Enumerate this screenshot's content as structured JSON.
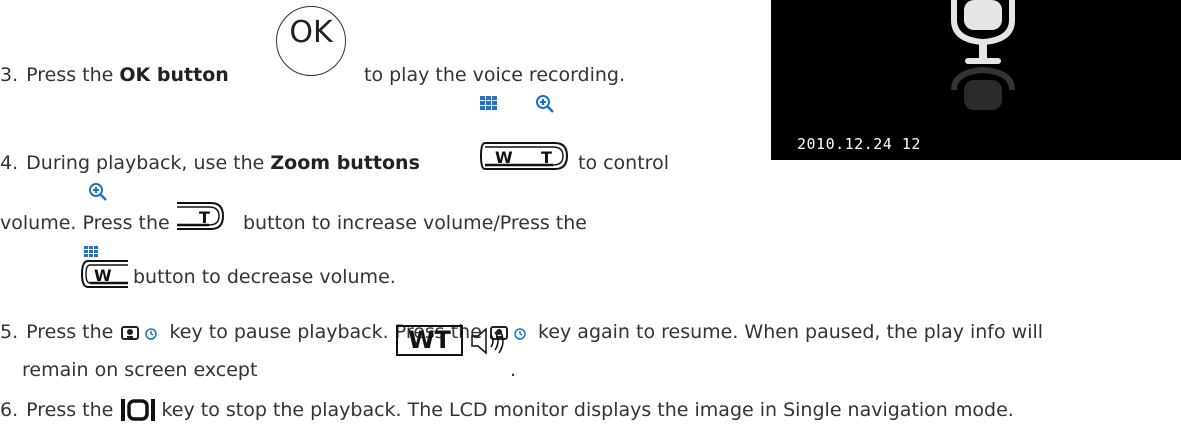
{
  "steps": [
    {
      "num": "3.",
      "pre": "Press the ",
      "bold": "OK button",
      "post": "to play the voice recording."
    },
    {
      "num": "4.",
      "pre": "During playback, use the ",
      "bold": "Zoom buttons",
      "post": "to control"
    },
    {
      "line2_pre": "volume. Press the ",
      "line2_post": "button to increase volume/Press the"
    },
    {
      "line3_post": "button to decrease volume."
    },
    {
      "num": "5.",
      "text_a": "Press the ",
      "text_b": " key to pause playback. Press the ",
      "text_c": " key again to resume. When paused, the play info will"
    },
    {
      "line2": "remain on screen except",
      "line2_end": "."
    },
    {
      "num": "6.",
      "pre": "Press the ",
      "post": " key to stop the playback. The LCD monitor displays the image in Single navigation mode."
    }
  ],
  "ok_label": "OK",
  "wt_label": "WT",
  "w_label": "W",
  "t_label": "T",
  "screen": {
    "timestamp": "2010.12.24  12"
  },
  "colors": {
    "accent": "#1a73c9",
    "text": "#333333"
  }
}
